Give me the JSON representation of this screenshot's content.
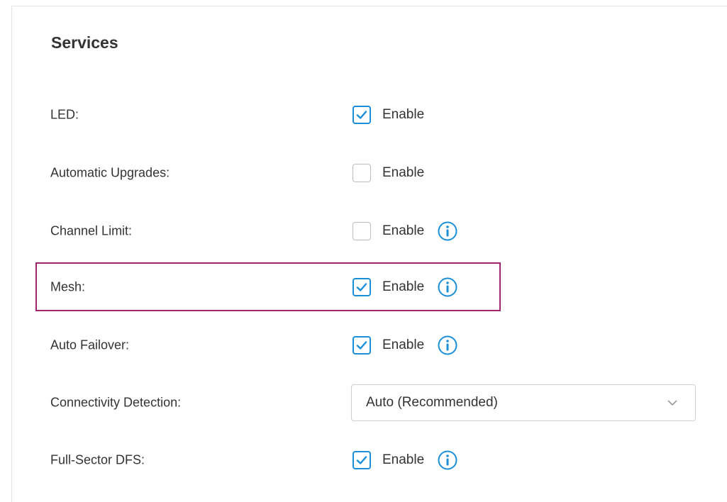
{
  "section": {
    "title": "Services"
  },
  "accent_color": "#1a8fd8",
  "highlight_color": "#a0246e",
  "rows": [
    {
      "label": "LED:",
      "control": "checkbox",
      "checked": true,
      "text": "Enable",
      "info": false
    },
    {
      "label": "Automatic Upgrades:",
      "control": "checkbox",
      "checked": false,
      "text": "Enable",
      "info": false
    },
    {
      "label": "Channel Limit:",
      "control": "checkbox",
      "checked": false,
      "text": "Enable",
      "info": true
    },
    {
      "label": "Mesh:",
      "control": "checkbox",
      "checked": true,
      "text": "Enable",
      "info": true
    },
    {
      "label": "Auto Failover:",
      "control": "checkbox",
      "checked": true,
      "text": "Enable",
      "info": true
    },
    {
      "label": "Connectivity Detection:",
      "control": "select",
      "value": "Auto (Recommended)"
    },
    {
      "label": "Full-Sector DFS:",
      "control": "checkbox",
      "checked": true,
      "text": "Enable",
      "info": true
    }
  ],
  "icons": {
    "info": "info-circle-icon",
    "check": "checkmark-icon",
    "dropdown": "chevron-down-icon"
  }
}
